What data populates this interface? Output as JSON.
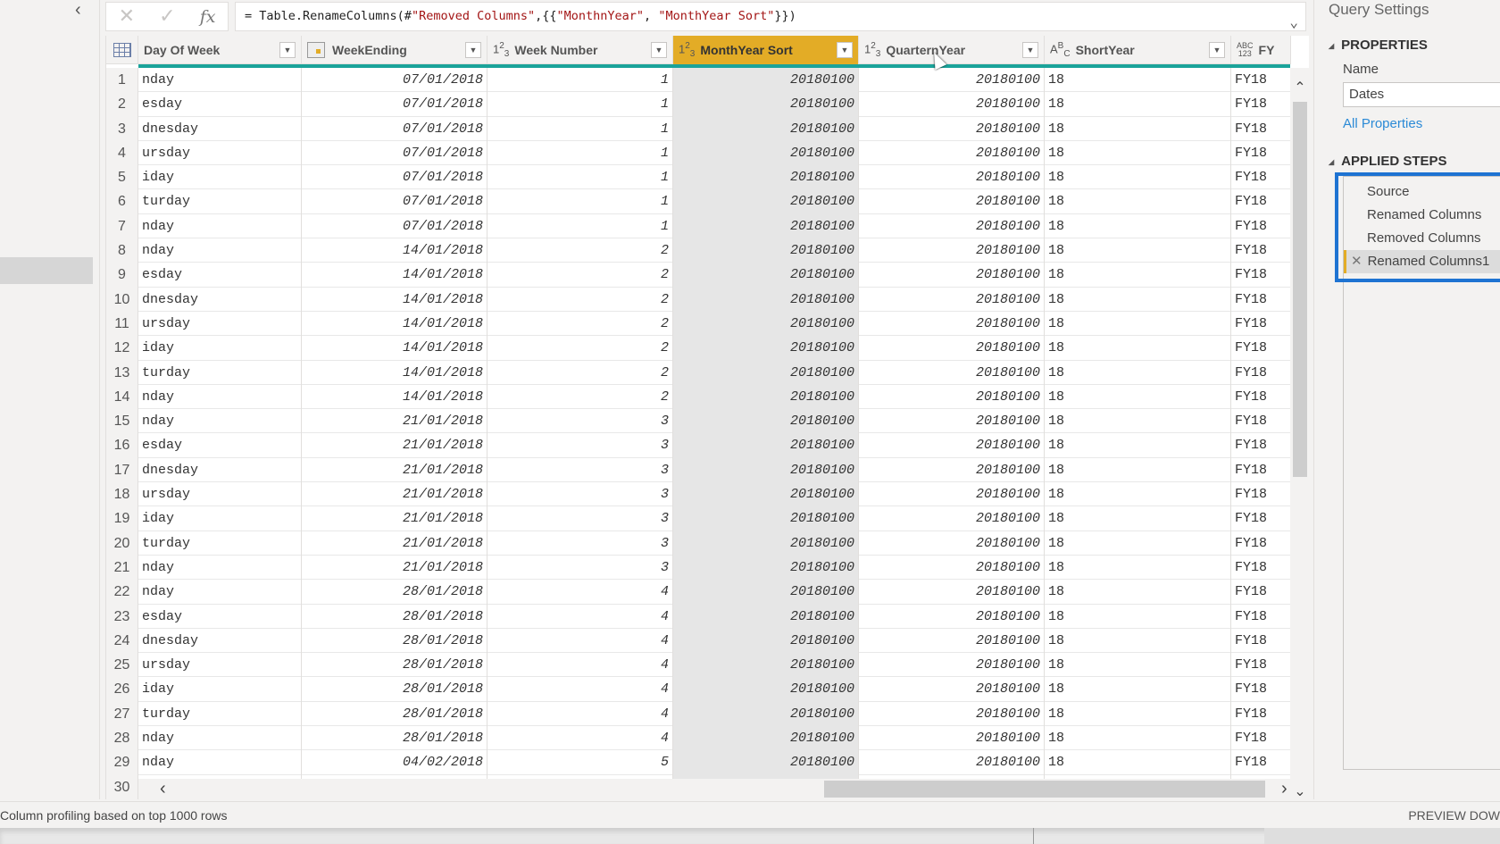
{
  "formula_bar": {
    "cancel_icon": "close-icon",
    "commit_icon": "check-icon",
    "fx_label": "fx",
    "formula_prefix": "= Table.RenameColumns(#",
    "formula_str1": "\"Removed Columns\"",
    "formula_mid": ",{{",
    "formula_str2": "\"MonthnYear\"",
    "formula_comma": ", ",
    "formula_str3": "\"MonthYear Sort\"",
    "formula_suffix": "}})"
  },
  "grid": {
    "columns": [
      {
        "name": "Day Of Week",
        "type_icon": "table-menu-icon",
        "type": ""
      },
      {
        "name": "WeekEnding",
        "type_icon": "calendar-icon",
        "type": ""
      },
      {
        "name": "Week Number",
        "type_icon": "whole-number-icon",
        "type": "123"
      },
      {
        "name": "MonthYear Sort",
        "type_icon": "whole-number-icon",
        "type": "123",
        "selected": true
      },
      {
        "name": "QuarternYear",
        "type_icon": "whole-number-icon",
        "type": "123"
      },
      {
        "name": "ShortYear",
        "type_icon": "text-icon",
        "type": "ABC"
      },
      {
        "name": "FY",
        "type_icon": "any-type-icon",
        "type": "ABC123"
      }
    ],
    "rows": [
      [
        "1",
        "nday",
        "07/01/2018",
        "1",
        "20180100",
        "20180100",
        "18",
        "FY18"
      ],
      [
        "2",
        "esday",
        "07/01/2018",
        "1",
        "20180100",
        "20180100",
        "18",
        "FY18"
      ],
      [
        "3",
        "dnesday",
        "07/01/2018",
        "1",
        "20180100",
        "20180100",
        "18",
        "FY18"
      ],
      [
        "4",
        "ursday",
        "07/01/2018",
        "1",
        "20180100",
        "20180100",
        "18",
        "FY18"
      ],
      [
        "5",
        "iday",
        "07/01/2018",
        "1",
        "20180100",
        "20180100",
        "18",
        "FY18"
      ],
      [
        "6",
        "turday",
        "07/01/2018",
        "1",
        "20180100",
        "20180100",
        "18",
        "FY18"
      ],
      [
        "7",
        "nday",
        "07/01/2018",
        "1",
        "20180100",
        "20180100",
        "18",
        "FY18"
      ],
      [
        "8",
        "nday",
        "14/01/2018",
        "2",
        "20180100",
        "20180100",
        "18",
        "FY18"
      ],
      [
        "9",
        "esday",
        "14/01/2018",
        "2",
        "20180100",
        "20180100",
        "18",
        "FY18"
      ],
      [
        "10",
        "dnesday",
        "14/01/2018",
        "2",
        "20180100",
        "20180100",
        "18",
        "FY18"
      ],
      [
        "11",
        "ursday",
        "14/01/2018",
        "2",
        "20180100",
        "20180100",
        "18",
        "FY18"
      ],
      [
        "12",
        "iday",
        "14/01/2018",
        "2",
        "20180100",
        "20180100",
        "18",
        "FY18"
      ],
      [
        "13",
        "turday",
        "14/01/2018",
        "2",
        "20180100",
        "20180100",
        "18",
        "FY18"
      ],
      [
        "14",
        "nday",
        "14/01/2018",
        "2",
        "20180100",
        "20180100",
        "18",
        "FY18"
      ],
      [
        "15",
        "nday",
        "21/01/2018",
        "3",
        "20180100",
        "20180100",
        "18",
        "FY18"
      ],
      [
        "16",
        "esday",
        "21/01/2018",
        "3",
        "20180100",
        "20180100",
        "18",
        "FY18"
      ],
      [
        "17",
        "dnesday",
        "21/01/2018",
        "3",
        "20180100",
        "20180100",
        "18",
        "FY18"
      ],
      [
        "18",
        "ursday",
        "21/01/2018",
        "3",
        "20180100",
        "20180100",
        "18",
        "FY18"
      ],
      [
        "19",
        "iday",
        "21/01/2018",
        "3",
        "20180100",
        "20180100",
        "18",
        "FY18"
      ],
      [
        "20",
        "turday",
        "21/01/2018",
        "3",
        "20180100",
        "20180100",
        "18",
        "FY18"
      ],
      [
        "21",
        "nday",
        "21/01/2018",
        "3",
        "20180100",
        "20180100",
        "18",
        "FY18"
      ],
      [
        "22",
        "nday",
        "28/01/2018",
        "4",
        "20180100",
        "20180100",
        "18",
        "FY18"
      ],
      [
        "23",
        "esday",
        "28/01/2018",
        "4",
        "20180100",
        "20180100",
        "18",
        "FY18"
      ],
      [
        "24",
        "dnesday",
        "28/01/2018",
        "4",
        "20180100",
        "20180100",
        "18",
        "FY18"
      ],
      [
        "25",
        "ursday",
        "28/01/2018",
        "4",
        "20180100",
        "20180100",
        "18",
        "FY18"
      ],
      [
        "26",
        "iday",
        "28/01/2018",
        "4",
        "20180100",
        "20180100",
        "18",
        "FY18"
      ],
      [
        "27",
        "turday",
        "28/01/2018",
        "4",
        "20180100",
        "20180100",
        "18",
        "FY18"
      ],
      [
        "28",
        "nday",
        "28/01/2018",
        "4",
        "20180100",
        "20180100",
        "18",
        "FY18"
      ],
      [
        "29",
        "nday",
        "04/02/2018",
        "5",
        "20180100",
        "20180100",
        "18",
        "FY18"
      ],
      [
        "30",
        "",
        "",
        "",
        "",
        "",
        "",
        ""
      ]
    ]
  },
  "query_settings": {
    "title": "Query Settings",
    "properties_label": "PROPERTIES",
    "name_label": "Name",
    "name_value": "Dates",
    "all_properties": "All Properties",
    "applied_steps_label": "APPLIED STEPS",
    "steps": [
      {
        "label": "Source"
      },
      {
        "label": "Renamed Columns"
      },
      {
        "label": "Removed Columns"
      },
      {
        "label": "Renamed Columns1",
        "active": true
      }
    ],
    "highlight_color": "#1e73d2"
  },
  "status_bar": {
    "left": "Column profiling based on top 1000 rows",
    "right": "PREVIEW DOW"
  },
  "colors": {
    "selected_column": "#e3ac26",
    "quality_bar": "#1aa39a",
    "link": "#2b8ad6"
  }
}
